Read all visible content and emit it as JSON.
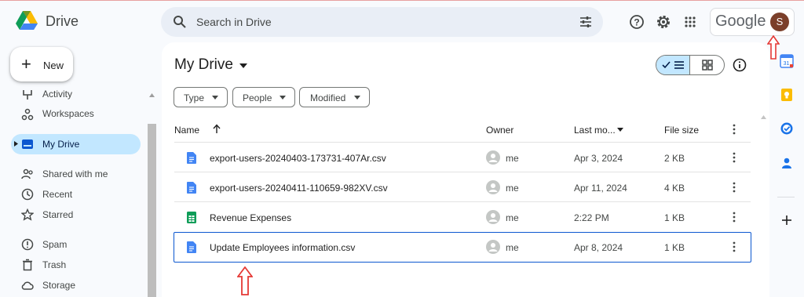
{
  "app": {
    "name": "Drive"
  },
  "search": {
    "placeholder": "Search in Drive"
  },
  "account": {
    "brand": "Google",
    "avatar_initial": "S"
  },
  "new_button": {
    "label": "New"
  },
  "nav": {
    "items": [
      {
        "label": "Activity"
      },
      {
        "label": "Workspaces"
      },
      {
        "label": "My Drive",
        "active": true
      },
      {
        "label": "Shared with me"
      },
      {
        "label": "Recent"
      },
      {
        "label": "Starred"
      },
      {
        "label": "Spam"
      },
      {
        "label": "Trash"
      },
      {
        "label": "Storage"
      }
    ]
  },
  "main": {
    "title": "My Drive",
    "filters": [
      {
        "label": "Type"
      },
      {
        "label": "People"
      },
      {
        "label": "Modified"
      }
    ],
    "columns": {
      "name": "Name",
      "owner": "Owner",
      "modified": "Last mo...",
      "size": "File size"
    },
    "files": [
      {
        "name": "export-users-20240403-173731-407Ar.csv",
        "type": "doc",
        "owner": "me",
        "modified": "Apr 3, 2024",
        "size": "2 KB"
      },
      {
        "name": "export-users-20240411-110659-982XV.csv",
        "type": "doc",
        "owner": "me",
        "modified": "Apr 11, 2024",
        "size": "4 KB"
      },
      {
        "name": "Revenue Expenses",
        "type": "sheet",
        "owner": "me",
        "modified": "2:22 PM",
        "size": "1 KB"
      },
      {
        "name": "Update Employees information.csv",
        "type": "doc",
        "owner": "me",
        "modified": "Apr 8, 2024",
        "size": "1 KB",
        "selected": true
      }
    ]
  },
  "colors": {
    "accent": "#0b57d0",
    "active_nav": "#c2e7ff",
    "doc_blue": "#4285f4",
    "sheet_green": "#0f9d58",
    "annotation_red": "#e53935"
  }
}
